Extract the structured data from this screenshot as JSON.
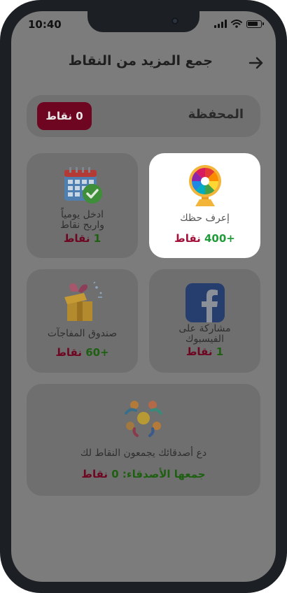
{
  "status": {
    "time": "10:40"
  },
  "header": {
    "title": "جمع المزيد من النقاط"
  },
  "wallet": {
    "label": "المحفظة",
    "badge": "0 نقاط"
  },
  "cards": [
    {
      "id": "lucky_wheel",
      "label": "إعرف حظك",
      "points_value": "+400",
      "points_unit": "نقاط",
      "icon": "prize-wheel-icon",
      "highlighted": true
    },
    {
      "id": "daily_login",
      "label_line1": "ادخل يومياً",
      "label_line2": "واربح نقاط",
      "points_value": "1",
      "points_unit": "نقاط",
      "icon": "calendar-check-icon"
    },
    {
      "id": "facebook_share",
      "label_line1": "مشاركة على",
      "label_line2": "الفيسبوك",
      "points_value": "1",
      "points_unit": "نقاط",
      "icon": "facebook-icon"
    },
    {
      "id": "surprise_box",
      "label": "صندوق المفاجآت",
      "points_value": "+60",
      "points_unit": "نقاط",
      "icon": "gift-box-icon"
    }
  ],
  "invite": {
    "text": "دع أصدقائك يجمعون النقاط لك",
    "collected_label": "جمعها الأصدقاء:",
    "collected_value": "0",
    "collected_unit": "نقاط",
    "icon": "friends-circle-icon"
  },
  "colors": {
    "accent": "#6e0622",
    "green": "#1f9b3a",
    "overlay": "#7c7c7c"
  }
}
